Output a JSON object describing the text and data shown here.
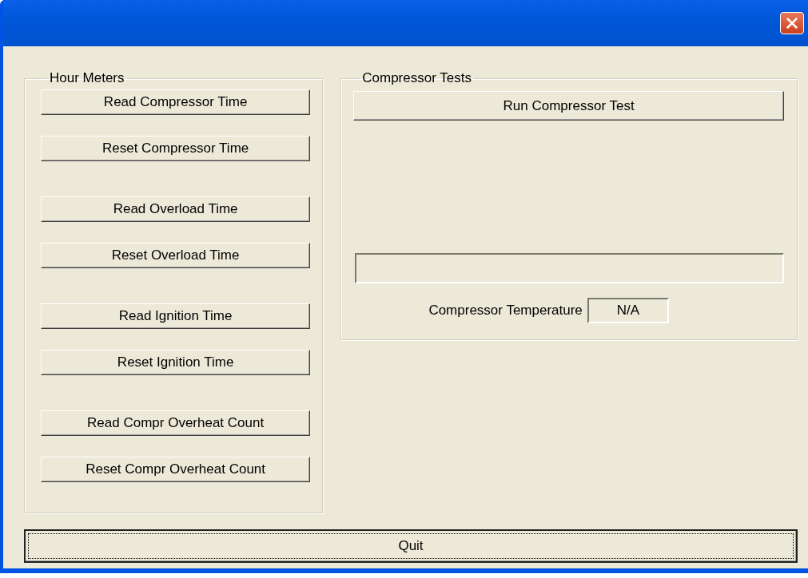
{
  "hour_meters": {
    "title": "Hour Meters",
    "button_groups": [
      [
        "Read Compressor Time",
        "Reset Compressor Time"
      ],
      [
        "Read Overload Time",
        "Reset Overload Time"
      ],
      [
        "Read Ignition Time",
        "Reset Ignition Time"
      ],
      [
        "Read Compr Overheat Count",
        "Reset Compr Overheat Count"
      ]
    ]
  },
  "compressor_tests": {
    "title": "Compressor Tests",
    "run_button": "Run Compressor Test",
    "progress": {
      "level": 0
    },
    "temperature": {
      "label": "Compressor Temperature",
      "value": "N/A"
    }
  },
  "quit_button": {
    "label": "Quit",
    "focused": true
  }
}
